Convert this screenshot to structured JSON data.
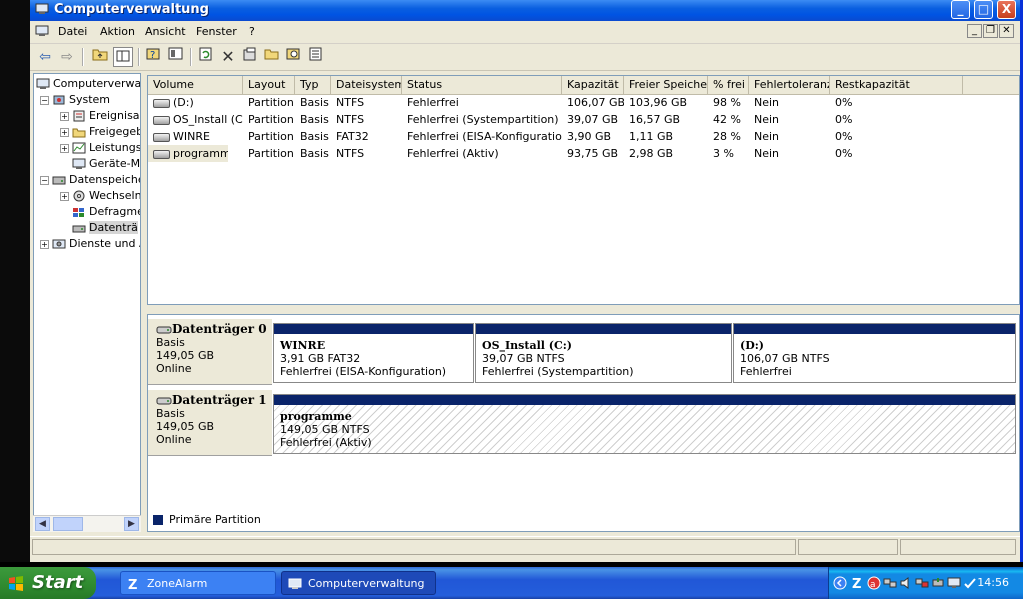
{
  "window": {
    "title": "Computerverwaltung",
    "controls": {
      "minimize": "_",
      "maximize": "□",
      "close": "X"
    }
  },
  "menu": {
    "items": [
      "Datei",
      "Aktion",
      "Ansicht",
      "Fenster",
      "?"
    ],
    "mdi_controls": {
      "minimize": "_",
      "restore": "❐",
      "close": "✕"
    }
  },
  "toolbar": {
    "icons": [
      "back-arrow-icon",
      "forward-arrow-icon",
      "up-folder-icon",
      "show-hide-tree-icon",
      "help-icon",
      "properties-console-icon",
      "refresh-icon",
      "delete-icon",
      "properties-icon",
      "open-icon",
      "search-icon",
      "export-icon"
    ]
  },
  "tree": {
    "items": [
      {
        "label": "Computerverwalt",
        "indent": 0,
        "expander": "",
        "icon": "computer-icon",
        "selected": false
      },
      {
        "label": "System",
        "indent": 1,
        "expander": "−",
        "icon": "system-tools-icon",
        "selected": false
      },
      {
        "label": "Ereignisa",
        "indent": 2,
        "expander": "+",
        "icon": "event-viewer-icon",
        "selected": false
      },
      {
        "label": "Freigegeb",
        "indent": 2,
        "expander": "+",
        "icon": "shared-folders-icon",
        "selected": false
      },
      {
        "label": "Leistungs",
        "indent": 2,
        "expander": "+",
        "icon": "performance-icon",
        "selected": false
      },
      {
        "label": "Geräte-M",
        "indent": 2,
        "expander": "",
        "icon": "device-manager-icon",
        "selected": false
      },
      {
        "label": "Datenspeiche",
        "indent": 1,
        "expander": "−",
        "icon": "storage-icon",
        "selected": false
      },
      {
        "label": "Wechseln",
        "indent": 2,
        "expander": "+",
        "icon": "removable-storage-icon",
        "selected": false
      },
      {
        "label": "Defragme",
        "indent": 2,
        "expander": "",
        "icon": "defrag-icon",
        "selected": false
      },
      {
        "label": "Datenträ",
        "indent": 2,
        "expander": "",
        "icon": "disk-management-icon",
        "selected": true
      },
      {
        "label": "Dienste und A",
        "indent": 1,
        "expander": "+",
        "icon": "services-icon",
        "selected": false
      }
    ]
  },
  "volumes": {
    "columns": [
      "Volume",
      "Layout",
      "Typ",
      "Dateisystem",
      "Status",
      "Kapazität",
      "Freier Speicher",
      "% frei",
      "Fehlertoleranz",
      "Restkapazität"
    ],
    "rows": [
      [
        "(D:)",
        "Partition",
        "Basis",
        "NTFS",
        "Fehlerfrei",
        "106,07 GB",
        "103,96 GB",
        "98 %",
        "Nein",
        "0%"
      ],
      [
        "OS_Install (C:)",
        "Partition",
        "Basis",
        "NTFS",
        "Fehlerfrei (Systempartition)",
        "39,07 GB",
        "16,57 GB",
        "42 %",
        "Nein",
        "0%"
      ],
      [
        "WINRE",
        "Partition",
        "Basis",
        "FAT32",
        "Fehlerfrei (EISA-Konfiguration)",
        "3,90 GB",
        "1,11 GB",
        "28 %",
        "Nein",
        "0%"
      ],
      [
        "programme",
        "Partition",
        "Basis",
        "NTFS",
        "Fehlerfrei (Aktiv)",
        "93,75 GB",
        "2,98 GB",
        "3 %",
        "Nein",
        "0%"
      ]
    ]
  },
  "disks": [
    {
      "name": "Datenträger 0",
      "type": "Basis",
      "size": "149,05 GB",
      "state": "Online",
      "partitions": [
        {
          "name": "WINRE",
          "size": "3,91 GB FAT32",
          "status": "Fehlerfrei (EISA-Konfiguration)"
        },
        {
          "name": "OS_Install  (C:)",
          "size": "39,07 GB NTFS",
          "status": "Fehlerfrei (Systempartition)"
        },
        {
          "name": " (D:)",
          "size": "106,07 GB NTFS",
          "status": "Fehlerfrei"
        }
      ]
    },
    {
      "name": "Datenträger 1",
      "type": "Basis",
      "size": "149,05 GB",
      "state": "Online",
      "partitions": [
        {
          "name": "programme",
          "size": "149,05 GB NTFS",
          "status": "Fehlerfrei (Aktiv)"
        }
      ]
    }
  ],
  "legend": {
    "label": "Primäre Partition",
    "color": "#0A246A"
  },
  "taskbar": {
    "start": "Start",
    "tasks": [
      {
        "label": "ZoneAlarm",
        "active": false
      },
      {
        "label": "Computerverwaltung",
        "active": true
      }
    ],
    "clock": "14:56",
    "tray_icons": [
      "expand-tray-icon",
      "zonealarm-icon",
      "antivirus-icon",
      "network-icon",
      "volume-icon",
      "network-icon-2",
      "safely-remove-icon",
      "monitor-icon",
      "security-icon"
    ]
  },
  "colors": {
    "titlebar": "#0054E3",
    "partition_bar": "#0A246A",
    "taskbar": "#245EDB",
    "start": "#2F8A2F"
  }
}
